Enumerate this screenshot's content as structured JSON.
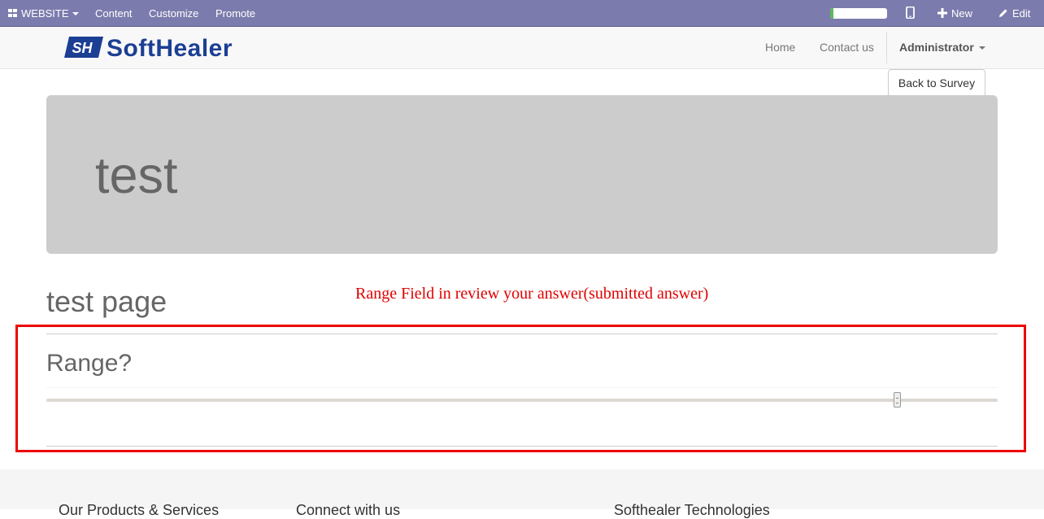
{
  "adminbar": {
    "website_label": "WEBSITE",
    "content_label": "Content",
    "customize_label": "Customize",
    "promote_label": "Promote",
    "progress_fraction": 0.05,
    "new_label": "New",
    "edit_label": "Edit",
    "icons": [
      "grid-icon",
      "mobile-icon",
      "plus-icon",
      "pencil-icon"
    ]
  },
  "navbar": {
    "logo_mark": "SH",
    "logo_text": "SoftHealer",
    "links": [
      "Home",
      "Contact us"
    ],
    "user": "Administrator"
  },
  "back_button_label": "Back to Survey",
  "survey": {
    "title": "test",
    "page_title": "test page",
    "question": "Range?",
    "range_value_fraction": 0.894
  },
  "annotation": "Range Field in review your answer(submitted answer)",
  "footer": {
    "headings": [
      "Our Products & Services",
      "Connect with us",
      "Softhealer Technologies"
    ]
  },
  "colors": {
    "adminbar": "#7c7bad",
    "brand": "#1c3f94",
    "annotation": "#e00000"
  }
}
